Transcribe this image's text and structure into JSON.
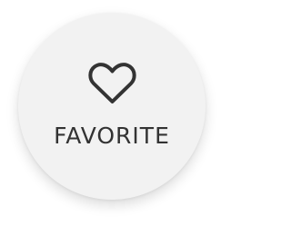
{
  "button": {
    "label": "FAVORITE",
    "icon": "heart-icon",
    "background_color": "#f2f2f2",
    "foreground_color": "#333333"
  }
}
